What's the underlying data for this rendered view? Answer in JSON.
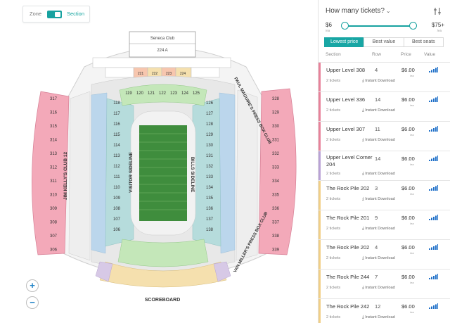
{
  "view_toggle": {
    "zone_label": "Zone",
    "section_label": "Section"
  },
  "venue": {
    "club_top": "Seneca Club",
    "club_top_section": "224 A",
    "scoreboard": "SCOREBOARD",
    "left_club": "JIM KELLY'S CLUB 12",
    "right_club_top": "PAUL MAGUIRE'S PRESS BOX CLUB",
    "right_club_bottom": "VAN MILLER'S PRESS BOX CLUB",
    "visitor_sideline": "VISITOR SIDELINE",
    "home_sideline": "BILLS SIDELINE",
    "left_upper_sections": [
      "317",
      "316",
      "315",
      "314",
      "313",
      "312",
      "311",
      "310",
      "309",
      "308",
      "307",
      "306"
    ],
    "right_upper_sections": [
      "328",
      "329",
      "330",
      "331",
      "332",
      "333",
      "334",
      "335",
      "336",
      "337",
      "338",
      "339"
    ],
    "top_lower_sections": [
      "119",
      "120",
      "121",
      "122",
      "123",
      "124",
      "125"
    ],
    "left_lower_sections": [
      "118",
      "117",
      "116",
      "115",
      "114",
      "113",
      "112",
      "111",
      "110",
      "109",
      "108",
      "107",
      "106"
    ],
    "right_lower_sections": [
      "126",
      "127",
      "128",
      "129",
      "130",
      "131",
      "132",
      "133",
      "134",
      "135",
      "136",
      "137",
      "138"
    ],
    "top_upper_sections": [
      "221",
      "222",
      "223",
      "224"
    ]
  },
  "zoom": {
    "in_label": "+",
    "out_label": "−"
  },
  "panel": {
    "title": "How many tickets?",
    "price_min": "$6",
    "price_min_sub": "/ea",
    "price_max": "$75+",
    "price_max_sub": "/ea",
    "slider_min_fraction": 0.0,
    "slider_max_fraction": 1.0,
    "sort_options": [
      "Lowest price",
      "Best value",
      "Best seats"
    ],
    "active_sort": "Lowest price",
    "columns": [
      "Section",
      "Row",
      "Price",
      "Value"
    ],
    "listings": [
      {
        "section": "Upper Level 308",
        "row": "4",
        "price": "$6.00",
        "each": "/ea",
        "tickets": "2 tickets",
        "delivery": "Instant Download",
        "color": "#e8829a"
      },
      {
        "section": "Upper Level 336",
        "row": "14",
        "price": "$6.00",
        "each": "/ea",
        "tickets": "2 tickets",
        "delivery": "Instant Download",
        "color": "#e8829a"
      },
      {
        "section": "Upper Level 307",
        "row": "11",
        "price": "$6.00",
        "each": "/ea",
        "tickets": "2 tickets",
        "delivery": "Instant Download",
        "color": "#e8829a"
      },
      {
        "section": "Upper Level Corner 204",
        "row": "14",
        "price": "$6.00",
        "each": "/ea",
        "tickets": "2 tickets",
        "delivery": "Instant Download",
        "color": "#b9a2d6"
      },
      {
        "section": "The Rock Pile 202",
        "row": "3",
        "price": "$6.00",
        "each": "/ea",
        "tickets": "2 tickets",
        "delivery": "Instant Download",
        "color": "#f1cf86"
      },
      {
        "section": "The Rock Pile 201",
        "row": "9",
        "price": "$6.00",
        "each": "/ea",
        "tickets": "2 tickets",
        "delivery": "Instant Download",
        "color": "#f1cf86"
      },
      {
        "section": "The Rock Pile 202",
        "row": "4",
        "price": "$6.00",
        "each": "/ea",
        "tickets": "2 tickets",
        "delivery": "Instant Download",
        "color": "#f1cf86"
      },
      {
        "section": "The Rock Pile 244",
        "row": "7",
        "price": "$6.00",
        "each": "/ea",
        "tickets": "2 tickets",
        "delivery": "Instant Download",
        "color": "#f1cf86"
      },
      {
        "section": "The Rock Pile 242",
        "row": "12",
        "price": "$6.00",
        "each": "/ea",
        "tickets": "2 tickets",
        "delivery": "Instant Download",
        "color": "#f1cf86"
      }
    ]
  },
  "colors": {
    "accent": "#17a2a0",
    "upper_pink": "#f3a9b9",
    "club_teal": "#b6dcdc",
    "lower_green": "#c4e7b9",
    "field_green": "#3f8d3d",
    "lower_blue": "#bbd6ec",
    "rockpile_yellow": "#f5e0ae",
    "corner_purple": "#d7c9e6",
    "value_bars": "#1e6fc8"
  }
}
